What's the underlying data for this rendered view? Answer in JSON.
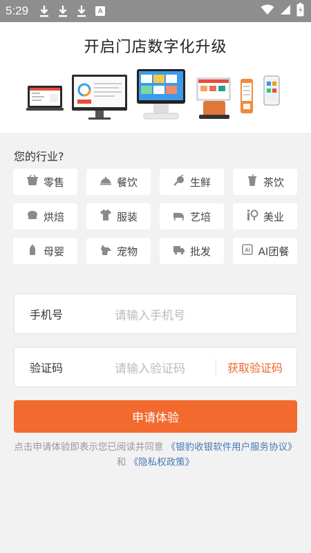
{
  "status_bar": {
    "time": "5:29",
    "badge": "A"
  },
  "hero": {
    "title": "开启门店数字化升级"
  },
  "industry": {
    "label": "您的行业?",
    "items": [
      {
        "label": "零售",
        "icon": "basket-icon"
      },
      {
        "label": "餐饮",
        "icon": "cloche-icon"
      },
      {
        "label": "生鲜",
        "icon": "fresh-produce-icon"
      },
      {
        "label": "茶饮",
        "icon": "cup-icon"
      },
      {
        "label": "烘焙",
        "icon": "cake-icon"
      },
      {
        "label": "服装",
        "icon": "shirt-icon"
      },
      {
        "label": "艺培",
        "icon": "piano-icon"
      },
      {
        "label": "美业",
        "icon": "beauty-icon"
      },
      {
        "label": "母婴",
        "icon": "baby-bottle-icon"
      },
      {
        "label": "宠物",
        "icon": "pet-icon"
      },
      {
        "label": "批发",
        "icon": "truck-icon"
      },
      {
        "label": "AI团餐",
        "icon": "ai-icon"
      }
    ]
  },
  "form": {
    "phone_label": "手机号",
    "phone_placeholder": "请输入手机号",
    "code_label": "验证码",
    "code_placeholder": "请输入验证码",
    "get_code": "获取验证码",
    "submit": "申请体验"
  },
  "agreement": {
    "prefix": "点击申请体验即表示您已阅读并同意",
    "link1": "《银豹收银软件用户服务协议》",
    "middle": "和",
    "link2": "《隐私权政策》"
  },
  "colors": {
    "accent": "#f26a2e",
    "link": "#4a79b8",
    "status_bar": "#8e8e8e"
  }
}
